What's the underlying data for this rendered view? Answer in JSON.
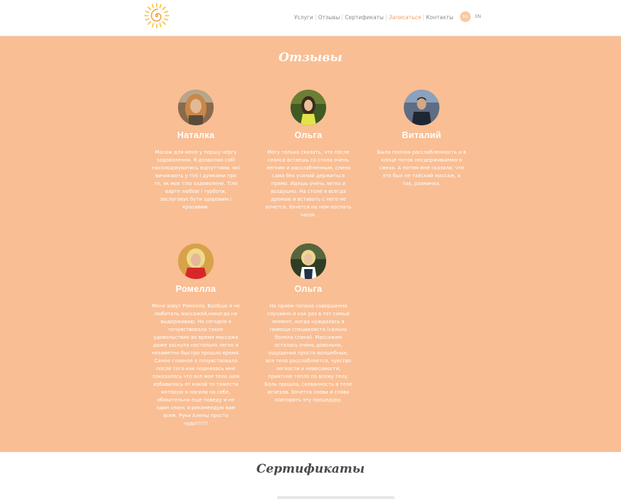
{
  "header": {
    "nav": [
      "Услуги",
      "Отзывы",
      "Сертификаты",
      "Записаться",
      "Контакты"
    ],
    "lang_ru": "RU",
    "lang_en": "EN",
    "colors": {
      "accent": "#f0a06a",
      "nav_text": "#8c8c8c"
    }
  },
  "reviews": {
    "title": "Отзывы",
    "background": "#f9be94",
    "items": [
      {
        "name": "Наталка",
        "text": "Масаж для мене у першу чергу задоволення. Я дозволяю собі насолоджуватись відчуттями, які вичикають у тілі і думками про те, як моє тіло задоволене. Тіло варте любові і турботи, заслуговує бути здоровим і красивим."
      },
      {
        "name": "Ольга",
        "text": "Могу только сказать, что после сеанса встаешь со стола очень легким и расслабленным, спина сама без усилий держиться прямо. Идешь очень легко и воздушно. На столе я всегда дремаю и вставать с него не хочется. Хочется на нем поспать часок."
      },
      {
        "name": "Виталий",
        "text": "Была полная расслабленность и в конце поток несдерживаемого смеха. А потом мне сказали, что это был не тайский массаж, а так, разминка."
      },
      {
        "name": "Ромелла",
        "text": "Меня зовут Ромелла. Вообще я не любитель массажей,никогда не выдерживаю. Но сегодня я почувствовала такое удовольствие во время массажа даже заснула настолько легко и незаметно быстро прошло время. Самое главное я почувствовала после того как поднялась мне показалось что все мое тело шея избавилась от какой то тяжести которую я носила на себе, обязательно еще поведу и не один сеанс я рекомендую вам всем. Руки Алены просто чудо!!!!!!"
      },
      {
        "name": "Ольга",
        "text": "На приём попала совершенно случайно и как раз в тот самый момент, когда нуждалась в помощи специалиста (сильно болела спина). Массажем осталась очень довольна, ощущения просто волшебные, все тело расслабляется, чувство легкости и невесомости, приятное тепло по всему телу. Боль прошла, скованность в теле исчезла. Хочется снова и снова повторять эту процедуру."
      }
    ]
  },
  "certificates": {
    "title": "Сертификаты"
  }
}
